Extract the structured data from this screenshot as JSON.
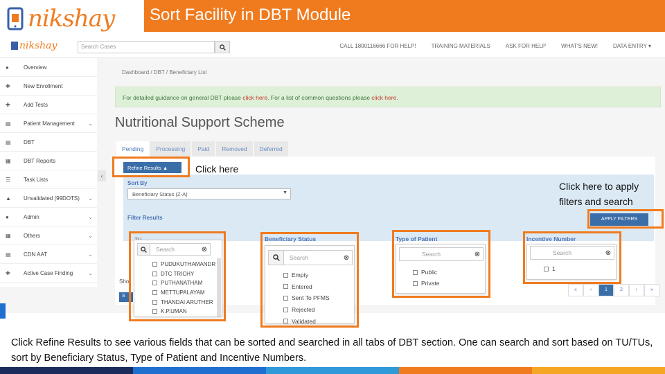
{
  "slide": {
    "logo_text": "nikshay",
    "title": "Sort Facility in DBT Module"
  },
  "app": {
    "logo_text": "nikshay",
    "search_placeholder": "Search Cases",
    "nav_links": [
      "CALL 1800116666 FOR HELP!",
      "TRAINING MATERIALS",
      "ASK FOR HELP",
      "WHAT'S NEW!",
      "DATA ENTRY ▾"
    ],
    "sidebar": [
      {
        "label": "Overview",
        "icon": "home-icon",
        "chevron": false
      },
      {
        "label": "New Enrollment",
        "icon": "plus-icon",
        "chevron": false
      },
      {
        "label": "Add Tests",
        "icon": "plus-icon",
        "chevron": false
      },
      {
        "label": "Patient Management",
        "icon": "id-card-icon",
        "chevron": true
      },
      {
        "label": "DBT",
        "icon": "card-icon",
        "chevron": false
      },
      {
        "label": "DBT Reports",
        "icon": "report-icon",
        "chevron": false
      },
      {
        "label": "Task Lists",
        "icon": "list-icon",
        "chevron": false
      },
      {
        "label": "Unvalidated (99DOTS)",
        "icon": "warning-icon",
        "chevron": true
      },
      {
        "label": "Admin",
        "icon": "user-icon",
        "chevron": true
      },
      {
        "label": "Others",
        "icon": "grid-icon",
        "chevron": true
      },
      {
        "label": "CDN AAT",
        "icon": "card-icon",
        "chevron": true
      },
      {
        "label": "Active Case Finding",
        "icon": "plus-icon",
        "chevron": true
      }
    ],
    "breadcrumb": "Dashboard  /  DBT  /  Beneficiary List",
    "alert": {
      "text1": "For detailed guidance on general DBT please ",
      "link1": "click here",
      "text2": ". For a list of common questions please ",
      "link2": "click here",
      "text3": "."
    },
    "heading": "Nutritional Support Scheme",
    "tabs": [
      "Pending",
      "Processing",
      "Paid",
      "Removed",
      "Deferred"
    ],
    "refine_label": "Refine Results",
    "sort_by_label": "Sort By",
    "sort_value": "Beneficiary Status (Z-A)",
    "filter_label": "Filter Results",
    "apply_label": "APPLY FILTERS",
    "tu_label": "TU",
    "show_label": "Sho",
    "s_label": "S",
    "pagination": [
      "«",
      "‹",
      "1",
      "2",
      "›",
      "»"
    ],
    "tu_dropdown": {
      "search_placeholder": "Search",
      "options": [
        "PUDUKUTHAMANDR",
        "DTC TRICHY",
        "PUTHANATHAM",
        "METTUPALAYAM",
        "THANDAI ARUTHER",
        "K.P.UMAN"
      ]
    },
    "status_dropdown": {
      "title": "Beneficiary Status",
      "search_placeholder": "Search",
      "options": [
        "Empty",
        "Entered",
        "Sent To PFMS",
        "Rejected",
        "Validated"
      ]
    },
    "patient_dropdown": {
      "title": "Type of Patient",
      "search_placeholder": "Search",
      "options": [
        "Public",
        "Private"
      ]
    },
    "incentive_dropdown": {
      "title": "Incentive Number",
      "search_placeholder": "Search",
      "options": [
        "1"
      ]
    }
  },
  "callouts": {
    "click_here": "Click here",
    "apply_hint_line1": "Click here to apply",
    "apply_hint_line2": "filters and search"
  },
  "caption": "Click Refine Results to see various fields that can be sorted and searched in all tabs of DBT section. One can search and sort based on TU/TUs, sort by Beneficiary Status, Type of Patient and Incentive Numbers.",
  "colors": {
    "brand_orange": "#f07b1f",
    "brand_blue": "#3a6ea8",
    "bottom_bar": [
      "#1a2b5c",
      "#1f6fd1",
      "#2e9ad8",
      "#f07b1f",
      "#f5a623"
    ]
  }
}
